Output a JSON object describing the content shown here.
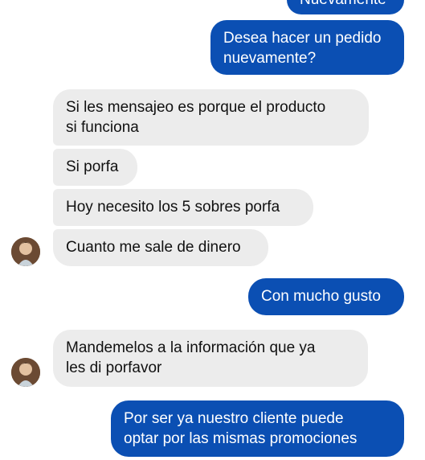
{
  "chat": {
    "messages": [
      {
        "sender": "me",
        "text": "Nuevamente"
      },
      {
        "sender": "me",
        "lines": [
          "Desea hacer un pedido",
          "nuevamente?"
        ]
      },
      {
        "sender": "contact",
        "lines": [
          "Si les mensajeo es porque el producto",
          "si funciona"
        ]
      },
      {
        "sender": "contact",
        "text": "Si porfa"
      },
      {
        "sender": "contact",
        "text": "Hoy necesito los 5 sobres porfa"
      },
      {
        "sender": "contact",
        "text": "Cuanto me sale de dinero"
      },
      {
        "sender": "me",
        "text": "Con mucho gusto"
      },
      {
        "sender": "contact",
        "lines": [
          "Mandemelos a la información que ya",
          "les di porfavor"
        ]
      },
      {
        "sender": "me",
        "lines": [
          "Por ser ya nuestro cliente puede",
          "optar por las mismas promociones"
        ]
      }
    ]
  },
  "colors": {
    "outgoing_bubble": "#0b4fb3",
    "incoming_bubble": "#ececec",
    "background": "#ffffff"
  },
  "icons": {
    "avatar": "contact-avatar"
  }
}
